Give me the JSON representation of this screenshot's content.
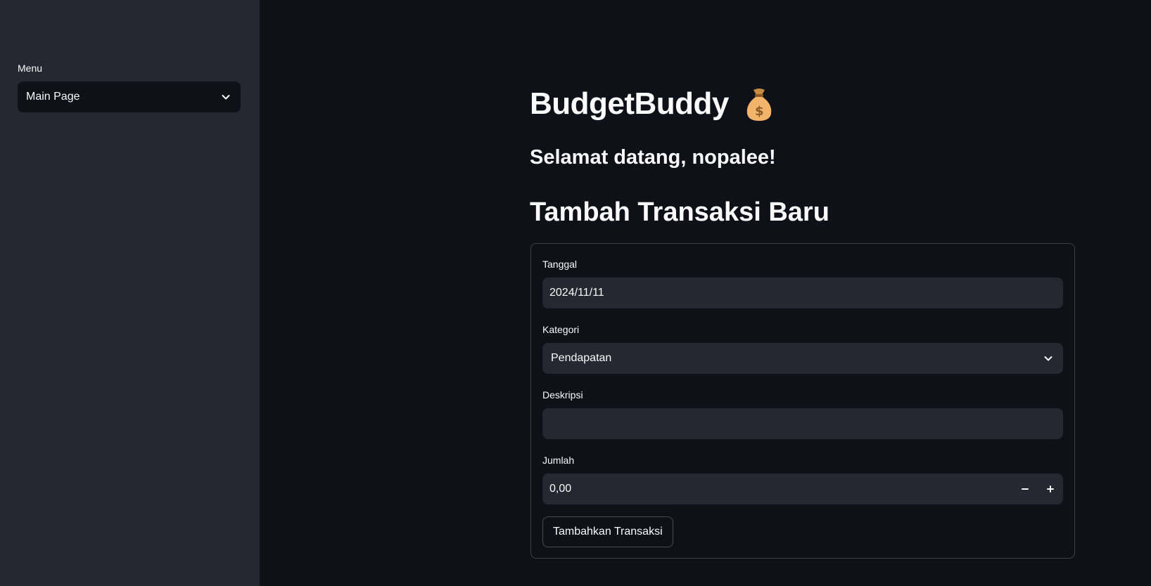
{
  "sidebar": {
    "menu_label": "Menu",
    "menu_selected": "Main Page",
    "bg_color": "#262730"
  },
  "main": {
    "title": "BudgetBuddy",
    "title_icon": "money-bag-icon",
    "welcome": "Selamat datang, nopalee!",
    "section_title": "Tambah Transaksi Baru"
  },
  "form": {
    "date_label": "Tanggal",
    "date_value": "2024/11/11",
    "category_label": "Kategori",
    "category_value": "Pendapatan",
    "description_label": "Deskripsi",
    "description_value": "",
    "amount_label": "Jumlah",
    "amount_value": "0,00",
    "submit_label": "Tambahkan Transaksi"
  },
  "colors": {
    "background": "#0e1117",
    "input_bg": "#262730",
    "text": "#fafafa",
    "accent_gold": "#f2b36b"
  }
}
